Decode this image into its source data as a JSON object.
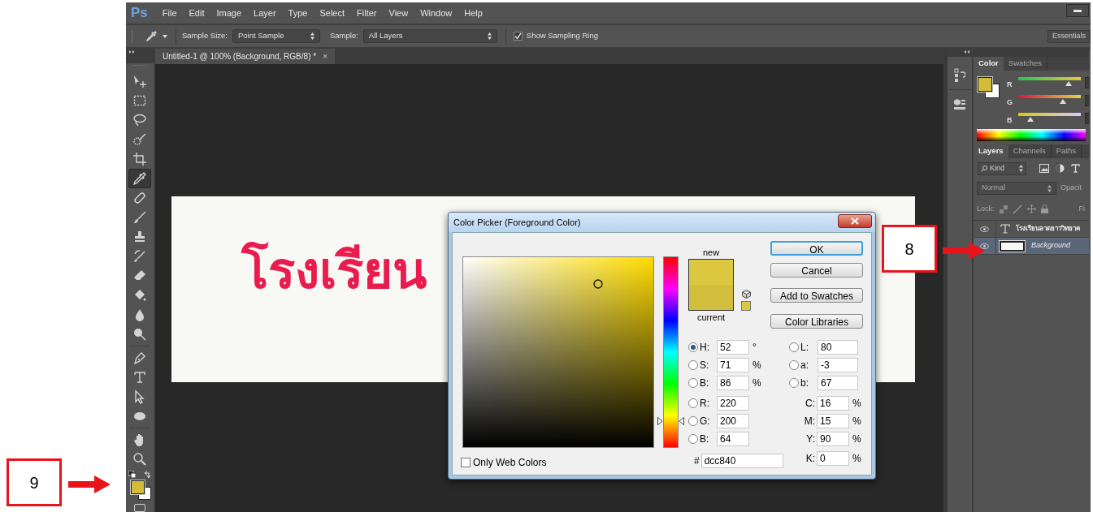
{
  "annotations": [
    {
      "label": "8"
    },
    {
      "label": "9"
    }
  ],
  "menu_bar": {
    "logo": "Ps",
    "items": [
      "File",
      "Edit",
      "Image",
      "Layer",
      "Type",
      "Select",
      "Filter",
      "View",
      "Window",
      "Help"
    ]
  },
  "options_bar": {
    "sample_size_label": "Sample Size:",
    "sample_size": "Point Sample",
    "sample_label": "Sample:",
    "sample": "All Layers",
    "sampling_ring": {
      "label": "Show Sampling Ring",
      "checked": true
    },
    "workspace": "Essentials"
  },
  "document_tab": {
    "title": "Untitled-1 @ 100% (Background, RGB/8) *",
    "close": "×"
  },
  "canvas": {
    "text": "โรงเรียน"
  },
  "toolbar": {
    "tool_groups": [
      [
        {
          "kind": "move",
          "selected": false
        },
        {
          "kind": "marquee",
          "selected": false
        },
        {
          "kind": "lasso",
          "selected": false
        },
        {
          "kind": "quick_select",
          "selected": false
        },
        {
          "kind": "crop",
          "selected": false
        },
        {
          "kind": "eyedropper",
          "selected": true
        },
        {
          "kind": "healing",
          "selected": false
        },
        {
          "kind": "brush",
          "selected": false
        },
        {
          "kind": "stamp",
          "selected": false
        },
        {
          "kind": "history_brush",
          "selected": false
        },
        {
          "kind": "eraser",
          "selected": false
        },
        {
          "kind": "bucket",
          "selected": false
        },
        {
          "kind": "blur",
          "selected": false
        },
        {
          "kind": "dodge",
          "selected": false
        }
      ],
      [
        {
          "kind": "pen",
          "selected": false
        },
        {
          "kind": "type",
          "selected": false
        },
        {
          "kind": "path_select",
          "selected": false
        },
        {
          "kind": "ellipse",
          "selected": false
        }
      ],
      [
        {
          "kind": "hand",
          "selected": false
        },
        {
          "kind": "zoom",
          "selected": false
        }
      ]
    ]
  },
  "color_picker": {
    "title": "Color Picker (Foreground Color)",
    "hue_slider": {
      "level": 0.14
    },
    "new_label": "new",
    "current_label": "current",
    "buttons": [
      {
        "label": "OK",
        "default": true
      },
      {
        "label": "Cancel",
        "default": false
      },
      {
        "label": "Add to Swatches",
        "default": false
      },
      {
        "label": "Color Libraries",
        "default": false
      }
    ],
    "hsb_fields": [
      {
        "label": "H:",
        "value": "52",
        "unit": "°",
        "selected": true
      },
      {
        "label": "S:",
        "value": "71",
        "unit": "%",
        "selected": false
      },
      {
        "label": "B:",
        "value": "86",
        "unit": "%",
        "selected": false
      }
    ],
    "rgb_fields": [
      {
        "label": "R:",
        "value": "220",
        "selected": false
      },
      {
        "label": "G:",
        "value": "200",
        "selected": false
      },
      {
        "label": "B:",
        "value": "64",
        "selected": false
      }
    ],
    "lab_fields": [
      {
        "label": "L:",
        "value": "80",
        "selected": false
      },
      {
        "label": "a:",
        "value": "-3",
        "selected": false
      },
      {
        "label": "b:",
        "value": "67",
        "selected": false
      }
    ],
    "cmyk_fields": [
      {
        "label": "C:",
        "value": "16",
        "unit": "%"
      },
      {
        "label": "M:",
        "value": "15",
        "unit": "%"
      },
      {
        "label": "Y:",
        "value": "90",
        "unit": "%"
      },
      {
        "label": "K:",
        "value": "0",
        "unit": "%"
      }
    ],
    "hex": {
      "label": "#",
      "value": "dcc840"
    },
    "only_web_colors": {
      "label": "Only Web Colors",
      "checked": false
    }
  },
  "color_panel": {
    "tabs": [
      {
        "label": "Color",
        "selected": true
      },
      {
        "label": "Swatches",
        "selected": false
      }
    ],
    "sliders": [
      {
        "label": "R",
        "level": 0.8
      },
      {
        "label": "G",
        "level": 0.72
      },
      {
        "label": "B",
        "level": 0.2
      }
    ]
  },
  "layers_panel": {
    "tabs": [
      {
        "label": "Layers",
        "selected": true
      },
      {
        "label": "Channels",
        "selected": false
      },
      {
        "label": "Paths",
        "selected": false
      }
    ],
    "filter": "Kind",
    "blend_mode": "Normal",
    "opacity_label": "Opacit",
    "lock_label": "Lock:",
    "fill_label": "Fi",
    "layers": [
      {
        "kind": "text",
        "name": "โรงเรียนลาดยาววิทยาค",
        "visible": true,
        "selected": false
      },
      {
        "kind": "image",
        "name": "Background",
        "visible": true,
        "selected": true
      }
    ]
  }
}
